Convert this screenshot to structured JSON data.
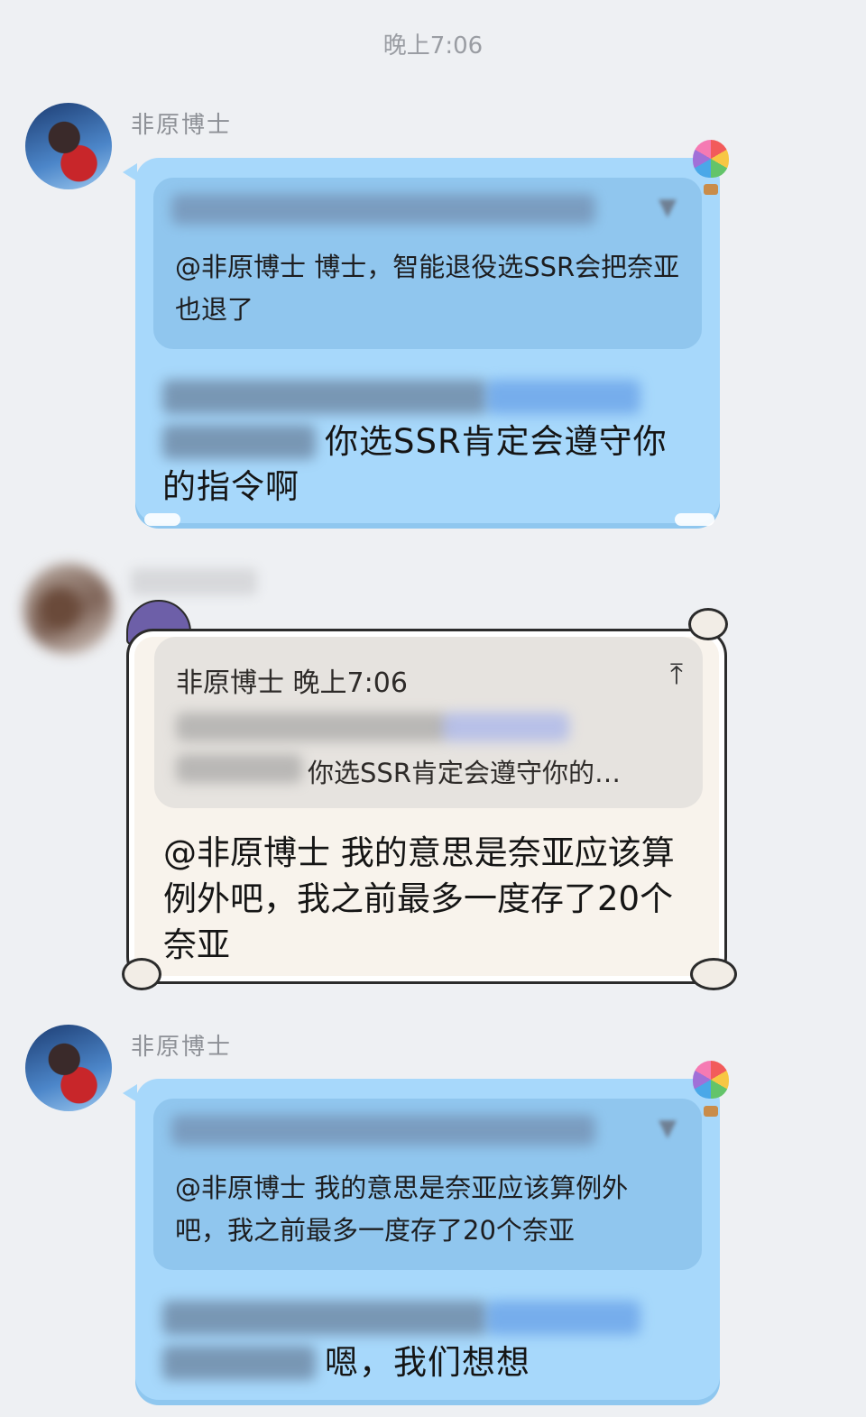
{
  "time_divider": "晚上7:06",
  "messages": [
    {
      "sender": "非原博士",
      "quote": {
        "text": "@非原博士 博士，智能退役选SSR会把奈亚也退了"
      },
      "text": "你选SSR肯定会遵守你的指令啊"
    },
    {
      "sender": "",
      "quote": {
        "header": "非原博士 晚上7:06",
        "text": "你选SSR肯定会遵守你的…"
      },
      "text": "@非原博士 我的意思是奈亚应该算例外吧，我之前最多一度存了20个奈亚"
    },
    {
      "sender": "非原博士",
      "quote": {
        "text": "@非原博士 我的意思是奈亚应该算例外吧，我之前最多一度存了20个奈亚"
      },
      "text": "嗯，我们想想"
    }
  ],
  "icons": {
    "balloon": "hot-air-balloon-icon",
    "quote_arrow": "arrow-up-to-line-icon"
  },
  "colors": {
    "background": "#eef0f3",
    "blue_bubble": "#a7d8fb",
    "cream_bubble": "#f8f3ec"
  }
}
